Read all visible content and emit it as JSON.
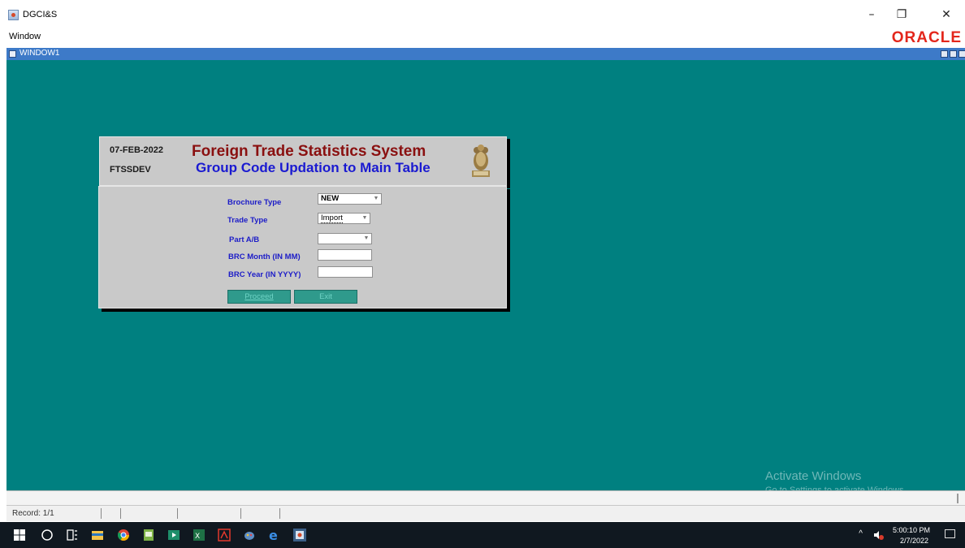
{
  "app": {
    "title": "DGCI&S",
    "menu_window": "Window",
    "vendor_logo": "ORACLE"
  },
  "inner_window": {
    "title": "WINDOW1"
  },
  "header": {
    "date": "07-FEB-2022",
    "user": "FTSSDEV",
    "title": "Foreign Trade Statistics System",
    "subtitle": "Group Code Updation to Main Table"
  },
  "form": {
    "brochure_type_label": "Brochure Type",
    "brochure_type_value": "NEW",
    "trade_type_label": "Trade Type",
    "trade_type_value": "Import",
    "part_label": "Part A/B",
    "part_value": "",
    "brc_month_label": "BRC Month (IN MM)",
    "brc_month_value": "",
    "brc_year_label": "BRC Year (IN YYYY)",
    "brc_year_value": "",
    "proceed_label": "Proceed",
    "exit_label": "Exit"
  },
  "status": {
    "record": "Record: 1/1"
  },
  "watermark": {
    "line1": "Activate Windows",
    "line2": "Go to Settings to activate Windows."
  },
  "taskbar": {
    "time": "5:00:10 PM",
    "date": "2/7/2022",
    "icons": [
      "windows-start-icon",
      "search-icon",
      "task-view-icon",
      "file-explorer-icon",
      "chrome-icon",
      "document-icon",
      "media-icon",
      "excel-icon",
      "pdf-icon",
      "paint-icon",
      "internet-explorer-icon",
      "java-app-icon"
    ]
  },
  "colors": {
    "canvas": "#008080",
    "title_red": "#8a1010",
    "subtitle_blue": "#1a1ad1",
    "label_blue": "#1c1cc8",
    "button_teal": "#2f9a8c",
    "oracle_red": "#e3261b"
  }
}
